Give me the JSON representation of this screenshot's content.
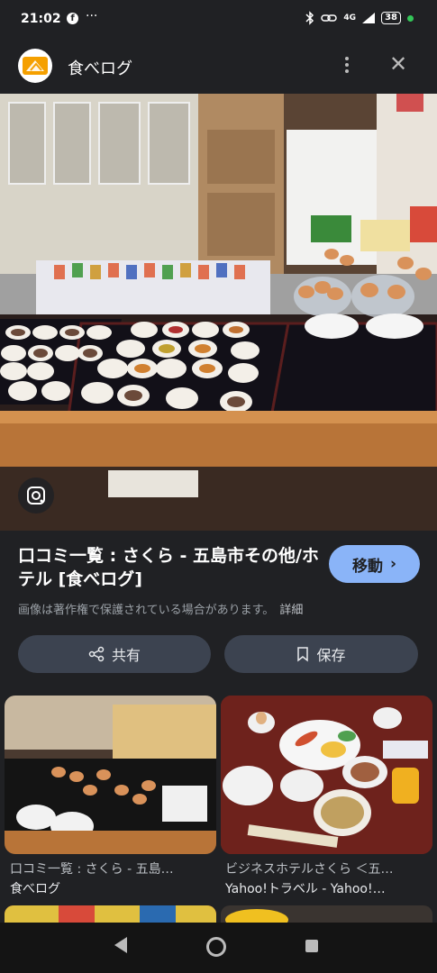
{
  "status_bar": {
    "time": "21:02",
    "more": "···",
    "network": "4G",
    "battery": "38"
  },
  "header": {
    "title": "食べログ"
  },
  "result": {
    "title": "口コミ一覧 : さくら - 五島市その他/ホテル [食べログ]",
    "visit_label": "移動",
    "copyright_notice": "画像は著作権で保護されている場合があります。",
    "details_label": "詳細"
  },
  "actions": {
    "share_label": "共有",
    "save_label": "保存"
  },
  "related": [
    {
      "title": "口コミ一覧 : さくら - 五島…",
      "source": "食べログ"
    },
    {
      "title": "ビジネスホテルさくら ＜五…",
      "source": "Yahoo!トラベル - Yahoo!…"
    }
  ],
  "colors": {
    "background": "#202124",
    "accent": "#8ab4f8",
    "button_bg": "#3c4350"
  }
}
